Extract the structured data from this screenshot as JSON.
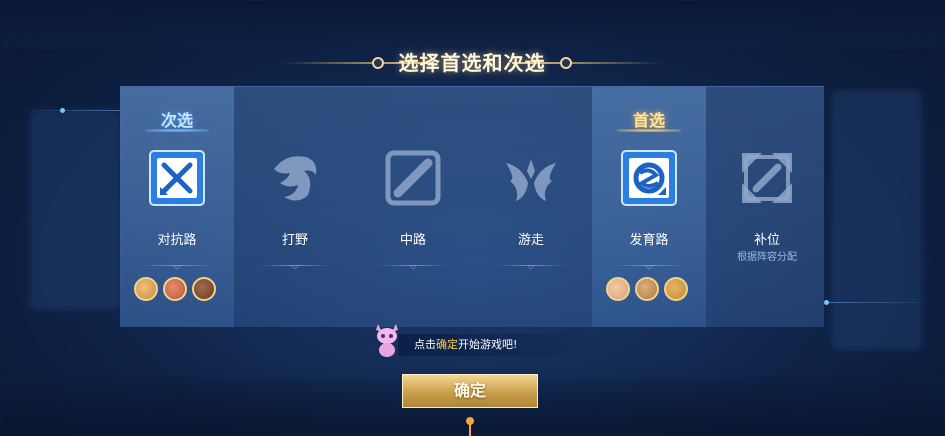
{
  "title": "选择首选和次选",
  "lanes": [
    {
      "name": "对抗路",
      "sub": "",
      "badge": "次选",
      "badge_type": "secondary",
      "icon": "clash-lane-icon",
      "selected": true,
      "avatar_colors": [
        "#c98a45",
        "#b55a3c",
        "#6b3b2a"
      ]
    },
    {
      "name": "打野",
      "sub": "",
      "badge": "",
      "badge_type": "",
      "icon": "jungle-dragon-icon",
      "selected": false,
      "avatar_colors": []
    },
    {
      "name": "中路",
      "sub": "",
      "badge": "",
      "badge_type": "",
      "icon": "mid-lane-icon",
      "selected": false,
      "avatar_colors": []
    },
    {
      "name": "游走",
      "sub": "",
      "badge": "",
      "badge_type": "",
      "icon": "roam-wings-icon",
      "selected": false,
      "avatar_colors": []
    },
    {
      "name": "发育路",
      "sub": "",
      "badge": "首选",
      "badge_type": "primary",
      "icon": "farm-lane-icon",
      "selected": true,
      "avatar_colors": [
        "#d9a27a",
        "#b07a4a",
        "#c48a3a"
      ]
    },
    {
      "name": "补位",
      "sub": "根据阵容分配",
      "badge": "",
      "badge_type": "",
      "icon": "fill-icon",
      "selected": false,
      "avatar_colors": []
    }
  ],
  "hint": {
    "prefix": "点击",
    "highlight": "确定",
    "suffix": "开始游戏吧!"
  },
  "confirm_label": "确定",
  "colors": {
    "accent_gold": "#f3cf7a",
    "primary_badge": "#ffe5a0",
    "secondary_badge": "#cfe6ff",
    "highlight": "#ffcf55"
  }
}
